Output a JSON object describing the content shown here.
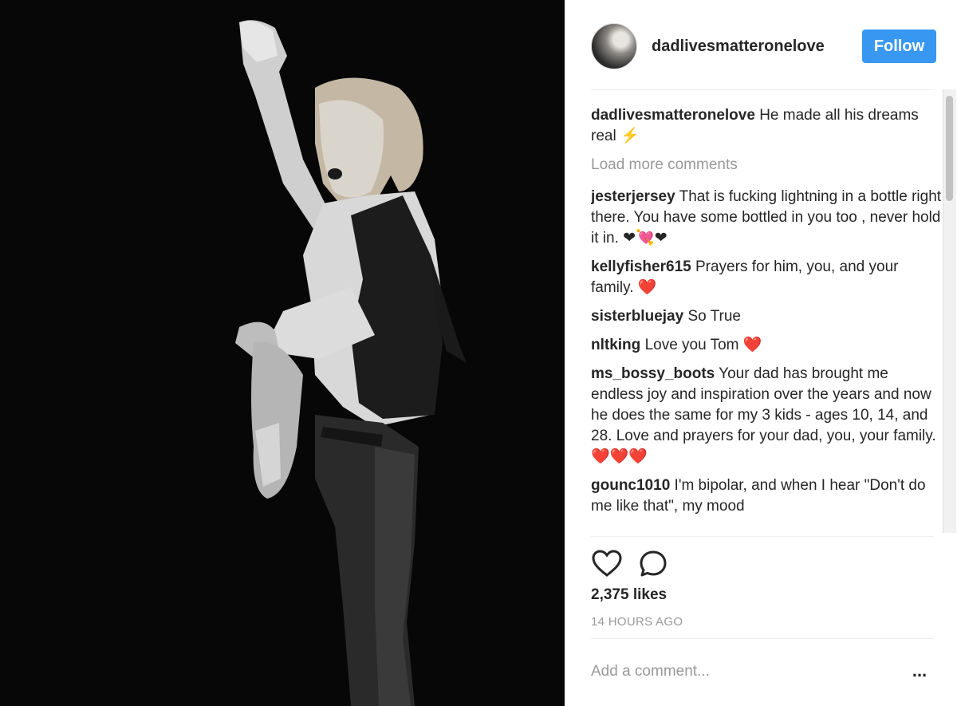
{
  "header": {
    "username": "dadlivesmatteronelove",
    "follow_label": "Follow"
  },
  "caption": {
    "username": "dadlivesmatteronelove",
    "text": "He made all his dreams real ⚡"
  },
  "load_more_label": "Load more comments",
  "comments": [
    {
      "username": "jesterjersey",
      "text": "That is fucking lightning in a bottle right there. You have some bottled in you too , never hold it in. ❤💘❤"
    },
    {
      "username": "kellyfisher615",
      "text": "Prayers for him, you, and your family.",
      "emoji": "❤️"
    },
    {
      "username": "sisterbluejay",
      "text": "So True"
    },
    {
      "username": "nltking",
      "text": "Love you Tom",
      "emoji": "❤️"
    },
    {
      "username": "ms_bossy_boots",
      "text": "Your dad has brought me endless joy and inspiration over the years and now he does the same for my 3 kids - ages 10, 14, and 28. Love and prayers for your dad, you, your family.",
      "emoji": "❤️❤️❤️"
    },
    {
      "username": "gounc1010",
      "text": "I'm bipolar, and when I hear \"Don't do me like that\", my mood"
    }
  ],
  "likes": "2,375 likes",
  "timestamp": "14 HOURS AGO",
  "add_comment_placeholder": "Add a comment...",
  "more_options_label": "...",
  "icons": {
    "like": "heart-outline-icon",
    "comment": "comment-bubble-icon",
    "more": "more-options-icon"
  },
  "colors": {
    "follow_button": "#3897f0",
    "muted_text": "#999999",
    "heart": "#e0263b"
  }
}
